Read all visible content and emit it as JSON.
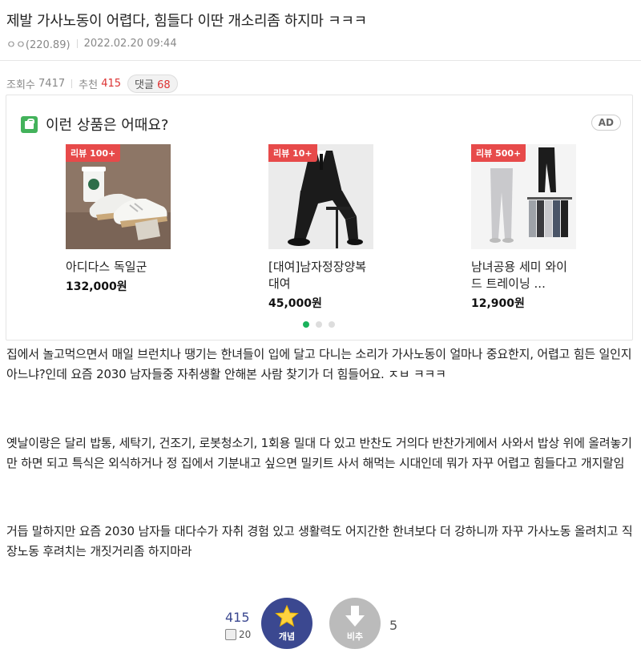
{
  "post": {
    "title": "제발 가사노동이 어렵다, 힘들다 이딴 개소리좀 하지마 ㅋㅋㅋ",
    "author": "ㅇㅇ(220.89)",
    "date": "2022.02.20 09:44",
    "views_label": "조회수",
    "views": "7417",
    "recommend_label": "추천",
    "recommend": "415",
    "comments_label": "댓글",
    "comments": "68"
  },
  "ad": {
    "title": "이런 상품은 어때요?",
    "badge": "AD",
    "products": [
      {
        "review": "리뷰 100+",
        "name": "아디다스 독일군",
        "price": "132,000원"
      },
      {
        "review": "리뷰 10+",
        "name": "[대여]남자정장양복대여",
        "price": "45,000원"
      },
      {
        "review": "리뷰 500+",
        "name": "남녀공용 세미 와이드 트레이닝 ...",
        "price": "12,900원"
      }
    ]
  },
  "content": {
    "p1": "집에서 놀고먹으면서 매일 브런치나 땡기는 한녀들이 입에 달고 다니는 소리가 가사노동이 얼마나 중요한지, 어렵고 힘든 일인지 아느냐?인데 요즘 2030 남자들중 자취생활 안해본 사람 찾기가 더 힘들어요. ㅈㅂ ㅋㅋㅋ",
    "p2": "옛날이랑은 달리 밥통, 세탁기, 건조기, 로봇청소기, 1회용 밀대 다 있고 반찬도 거의다 반찬가게에서 사와서 밥상 위에 올려놓기만 하면 되고 특식은 외식하거나 정 집에서 기분내고 싶으면 밀키트 사서 해먹는 시대인데 뭐가 자꾸 어렵고 힘들다고 개지랄임",
    "p3": "거듭 말하지만 요즘 2030 남자들 대다수가 자취 경험 있고 생활력도 어지간한 한녀보다 더 강하니까 자꾸 가사노동 올려치고 직장노동 후려치는 개짓거리좀 하지마라"
  },
  "vote": {
    "up_count": "415",
    "fix_count": "20",
    "up_label": "개념",
    "down_label": "비추",
    "down_count": "5"
  },
  "colors": {
    "accent": "#3b4890",
    "review_tag": "#e74a4a",
    "dot_active": "#1ab25c"
  }
}
